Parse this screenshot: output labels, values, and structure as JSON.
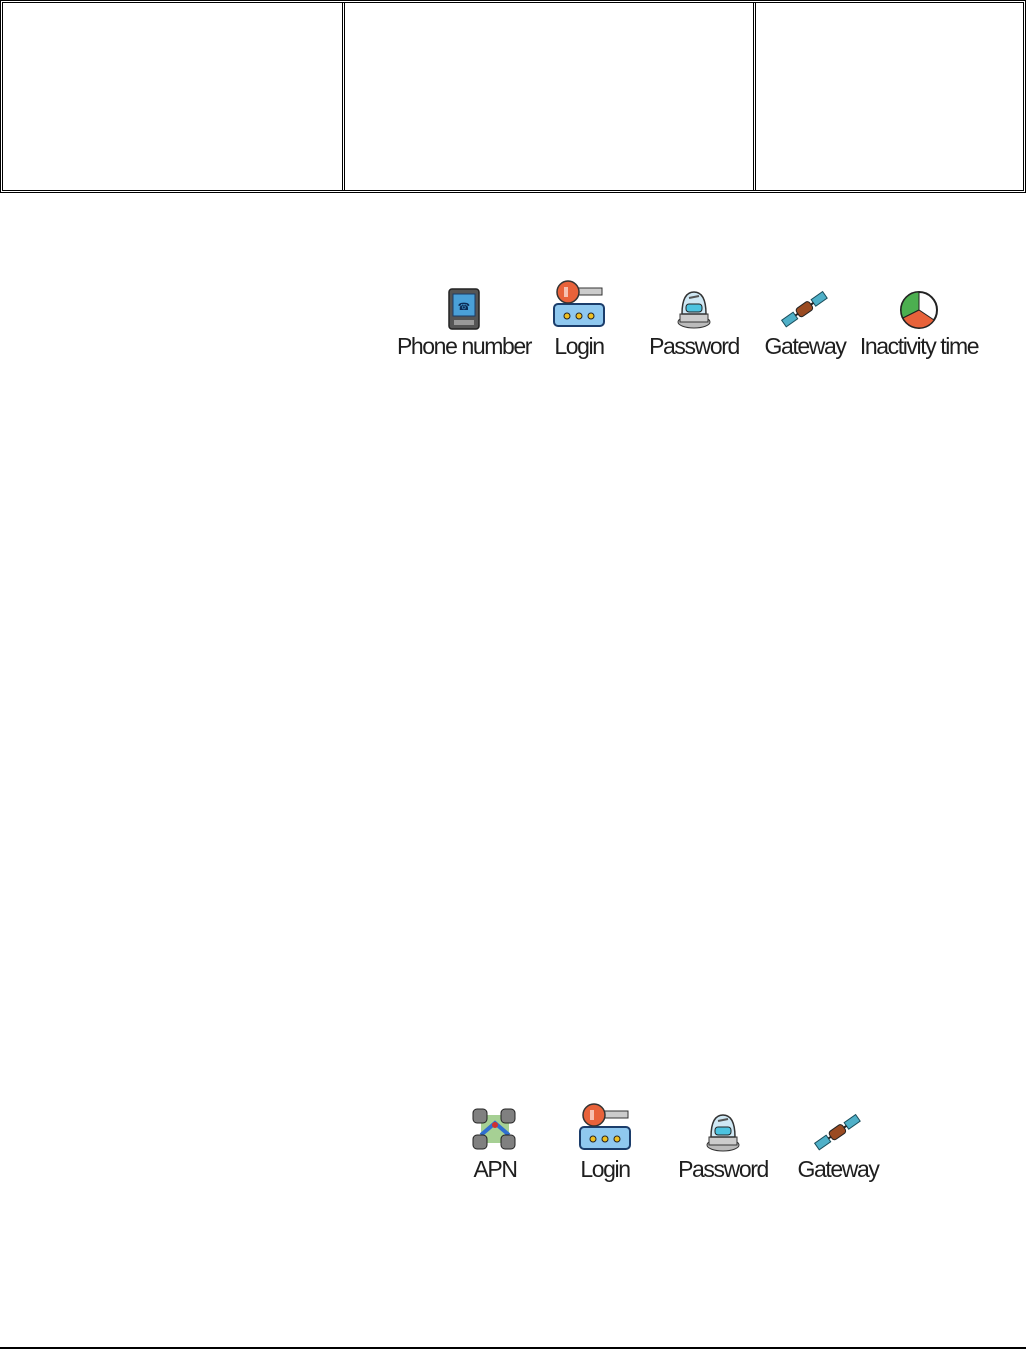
{
  "icons_row_1": [
    {
      "label": "Phone number",
      "icon": "phone-number-icon"
    },
    {
      "label": "Login",
      "icon": "key-login-icon"
    },
    {
      "label": "Password",
      "icon": "password-icon"
    },
    {
      "label": "Gateway",
      "icon": "satellite-gateway-icon"
    },
    {
      "label": "Inactivity time",
      "icon": "clock-inactivity-icon"
    }
  ],
  "icons_row_2": [
    {
      "label": "APN",
      "icon": "apn-network-icon"
    },
    {
      "label": "Login",
      "icon": "key-login-icon"
    },
    {
      "label": "Password",
      "icon": "password-icon"
    },
    {
      "label": "Gateway",
      "icon": "satellite-gateway-icon"
    }
  ],
  "colors": {
    "key_orange": "#e8623a",
    "icon_blue": "#4aa0d8",
    "border": "#000000"
  }
}
